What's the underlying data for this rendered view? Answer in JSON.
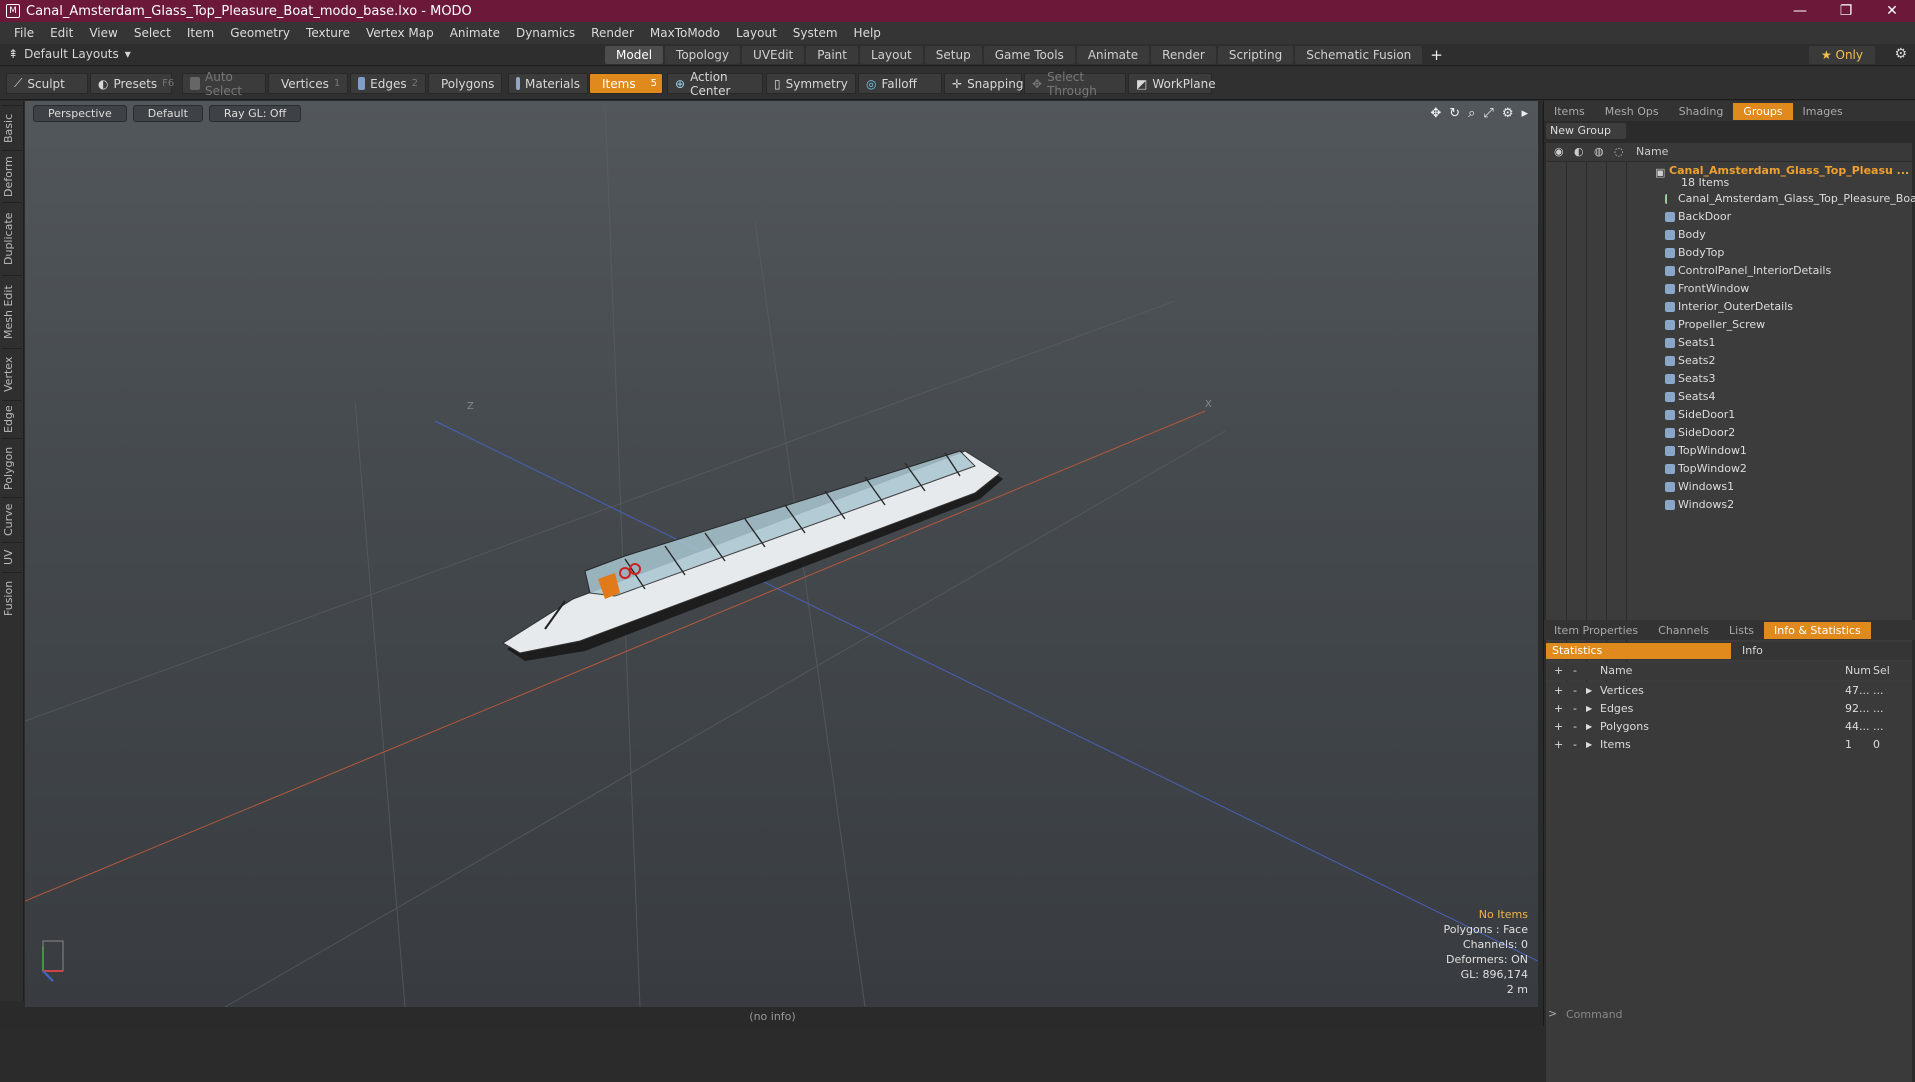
{
  "window": {
    "title": "Canal_Amsterdam_Glass_Top_Pleasure_Boat_modo_base.lxo - MODO",
    "minimize": "—",
    "restore": "❐",
    "close": "✕"
  },
  "menu": [
    "File",
    "Edit",
    "View",
    "Select",
    "Item",
    "Geometry",
    "Texture",
    "Vertex Map",
    "Animate",
    "Dynamics",
    "Render",
    "MaxToModo",
    "Layout",
    "System",
    "Help"
  ],
  "layout": {
    "dropdown": "Default Layouts",
    "tabs": [
      "Model",
      "Topology",
      "UVEdit",
      "Paint",
      "Layout",
      "Setup",
      "Game Tools",
      "Animate",
      "Render",
      "Scripting",
      "Schematic Fusion"
    ],
    "active_tab": "Model",
    "only": "★ Only"
  },
  "toolbar": {
    "sculpt": "Sculpt",
    "presets": "Presets",
    "presets_key": "F6",
    "auto_select": "Auto Select",
    "vertices": "Vertices",
    "vertices_key": "1",
    "edges": "Edges",
    "edges_key": "2",
    "polygons": "Polygons",
    "materials": "Materials",
    "items": "Items",
    "items_key": "5",
    "action_center": "Action Center",
    "symmetry": "Symmetry",
    "falloff": "Falloff",
    "snapping": "Snapping",
    "select_through": "Select Through",
    "workplane": "WorkPlane"
  },
  "left_tabs": [
    "Basic",
    "Deform",
    "Duplicate",
    "Mesh Edit",
    "Vertex",
    "Edge",
    "Polygon",
    "Curve",
    "UV",
    "Fusion"
  ],
  "viewport": {
    "view": "Perspective",
    "shading": "Default",
    "raygl": "Ray GL: Off",
    "axis_z": "Z",
    "axis_x": "X",
    "info": {
      "items": "No Items",
      "polygons": "Polygons : Face",
      "channels": "Channels: 0",
      "deformers": "Deformers: ON",
      "gl": "GL: 896,174",
      "scale": "2 m"
    }
  },
  "status": "(no info)",
  "groups_panel": {
    "tabs": [
      "Items",
      "Mesh Ops",
      "Shading",
      "Groups",
      "Images"
    ],
    "active": "Groups",
    "new_group": "New Group",
    "col_name": "Name",
    "group_name": "Canal_Amsterdam_Glass_Top_Pleasu ...",
    "group_count": "18 Items",
    "items": [
      "Canal_Amsterdam_Glass_Top_Pleasure_Boat",
      "BackDoor",
      "Body",
      "BodyTop",
      "ControlPanel_InteriorDetails",
      "FrontWindow",
      "Interior_OuterDetails",
      "Propeller_Screw",
      "Seats1",
      "Seats2",
      "Seats3",
      "Seats4",
      "SideDoor1",
      "SideDoor2",
      "TopWindow1",
      "TopWindow2",
      "Windows1",
      "Windows2"
    ]
  },
  "stats_panel": {
    "tabs": [
      "Item Properties",
      "Channels",
      "Lists",
      "Info & Statistics"
    ],
    "active": "Info & Statistics",
    "sub_statistics": "Statistics",
    "sub_info": "Info",
    "col_name": "Name",
    "col_num": "Num",
    "col_sel": "Sel",
    "rows": [
      {
        "name": "Vertices",
        "num": "47...",
        "sel": "..."
      },
      {
        "name": "Edges",
        "num": "92...",
        "sel": "..."
      },
      {
        "name": "Polygons",
        "num": "44...",
        "sel": "..."
      },
      {
        "name": "Items",
        "num": "1",
        "sel": "0"
      }
    ]
  },
  "command": {
    "placeholder": "Command",
    "prompt": ">"
  }
}
